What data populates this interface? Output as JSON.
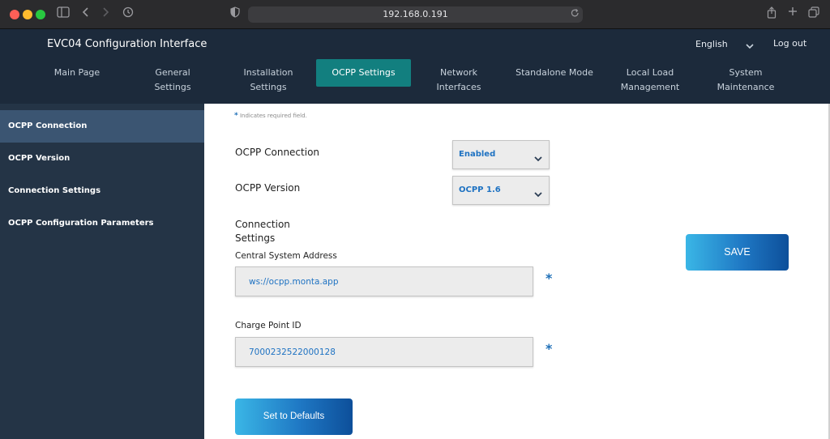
{
  "browser": {
    "url": "192.168.0.191"
  },
  "header": {
    "title": "EVC04 Configuration Interface",
    "language": "English",
    "logout": "Log out"
  },
  "nav": {
    "tabs": [
      {
        "label": "Main Page"
      },
      {
        "label": "General Settings"
      },
      {
        "label": "Installation Settings"
      },
      {
        "label": "OCPP Settings"
      },
      {
        "label": "Network Interfaces"
      },
      {
        "label": "Standalone Mode"
      },
      {
        "label": "Local Load Management"
      },
      {
        "label": "System Maintenance"
      }
    ],
    "active_index": 3
  },
  "sidebar": {
    "items": [
      {
        "label": "OCPP Connection"
      },
      {
        "label": "OCPP Version"
      },
      {
        "label": "Connection Settings"
      },
      {
        "label": "OCPP Configuration Parameters"
      }
    ],
    "active_index": 0
  },
  "form": {
    "required_note": "Indicates required field.",
    "required_star": "*",
    "ocpp_connection": {
      "label": "OCPP Connection",
      "value": "Enabled"
    },
    "ocpp_version": {
      "label": "OCPP Version",
      "value": "OCPP 1.6"
    },
    "connection_settings_heading": "Connection Settings",
    "central_system_address": {
      "label": "Central System Address",
      "value": "ws://ocpp.monta.app"
    },
    "charge_point_id": {
      "label": "Charge Point ID",
      "value": "7000232522000128"
    },
    "save_label": "SAVE",
    "defaults_label": "Set to Defaults"
  },
  "colors": {
    "header_bg": "#1c2a3b",
    "active_tab": "#127f7f",
    "sidebar_bg": "#243446",
    "sidebar_active": "#3b5572",
    "accent_text": "#1e72c2"
  }
}
